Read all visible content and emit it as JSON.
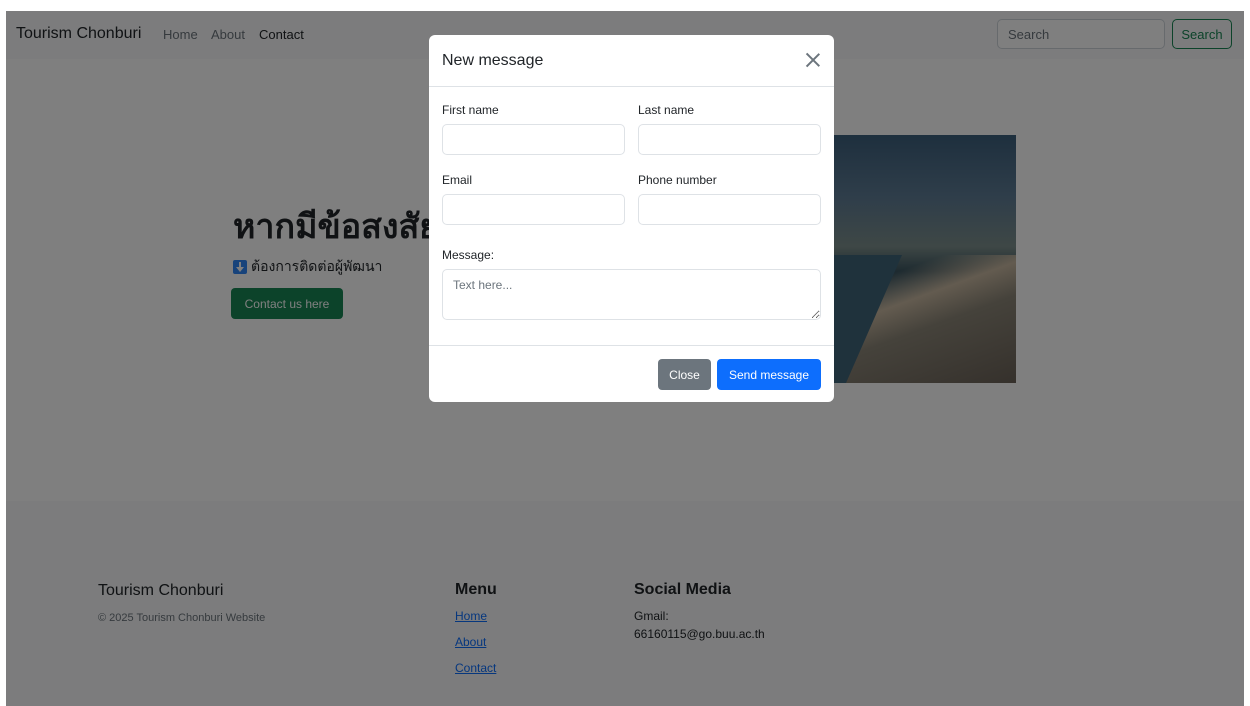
{
  "navbar": {
    "brand": "Tourism Chonburi",
    "links": [
      {
        "label": "Home"
      },
      {
        "label": "About"
      },
      {
        "label": "Contact"
      }
    ],
    "search_placeholder": "Search",
    "search_button": "Search"
  },
  "hero": {
    "title": "หากมีข้อสงสัย",
    "subtitle": "ต้องการติดต่อผู้พัฒนา",
    "button": "Contact us here"
  },
  "modal": {
    "title": "New message",
    "first_name_label": "First name",
    "last_name_label": "Last name",
    "email_label": "Email",
    "phone_label": "Phone number",
    "message_label": "Message:",
    "message_placeholder": "Text here...",
    "close_button": "Close",
    "send_button": "Send message"
  },
  "footer": {
    "brand": "Tourism Chonburi",
    "copyright": "© 2025 Tourism Chonburi Website",
    "menu_heading": "Menu",
    "menu_links": [
      {
        "label": "Home"
      },
      {
        "label": "About"
      },
      {
        "label": "Contact"
      }
    ],
    "social_heading": "Social Media",
    "gmail_label": "Gmail:",
    "gmail_address": "66160115@go.buu.ac.th"
  }
}
